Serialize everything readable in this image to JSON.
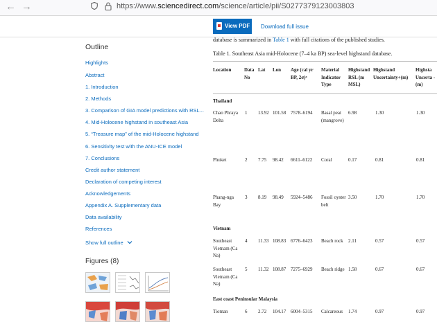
{
  "browser": {
    "url_prefix": "https://www.",
    "url_domain": "sciencedirect.com",
    "url_path": "/science/article/pii/S0277379123003803"
  },
  "toolbar": {
    "view_pdf": "View PDF",
    "download_issue": "Download full issue"
  },
  "outline": {
    "title": "Outline",
    "items": [
      "Highlights",
      "Abstract",
      "1. Introduction",
      "2. Methods",
      "3. Comparison of GIA model predictions with RSL...",
      "4. Mid-Holocene highstand in southeast Asia",
      "5. “Treasure map” of the mid-Holocene highstand",
      "6. Sensitivity test with the ANU-ICE model",
      "7. Conclusions",
      "Credit author statement",
      "Declaration of competing interest",
      "Acknowledgements",
      "Appendix A. Supplementary data",
      "Data availability",
      "References"
    ],
    "show_full": "Show full outline",
    "figures_title": "Figures (8)"
  },
  "article": {
    "lead_before": "database is summarized in ",
    "lead_link": "Table 1",
    "lead_after": " with full citations of the published studies.",
    "caption": "Table 1. Southeast Asia mid-Holocene (7–4 ka BP) sea-level highstand database.",
    "headers": {
      "location": "Location",
      "data_no": "Data No",
      "lat": "Lat",
      "lon": "Lon",
      "age": "Age (cal yr BP, 2σ)ᵃ",
      "material": "Material Indicator Type",
      "highstand_rsl": "Highstand RSL (m MSL)",
      "highstand_unc": "Highstand Uncertainty+(m)",
      "highstand_unc2": "Highsta Uncerta - (m)"
    },
    "regions": {
      "r1": "Thailand",
      "r2": "Vietnam",
      "r3": "East coast Peninsular Malaysia"
    },
    "rows": [
      {
        "location": "Chao Phraya Delta",
        "no": "1",
        "lat": "13.92",
        "lon": "101.58",
        "age": "7578–6194",
        "material": "Basal peat (mangrove)",
        "rsl": "6.98",
        "unc_plus": "1.30",
        "unc_minus": "1.30"
      },
      {
        "location": "Phuket",
        "no": "2",
        "lat": "7.75",
        "lon": "98.42",
        "age": "6611–6122",
        "material": "Coral",
        "rsl": "0.17",
        "unc_plus": "0.81",
        "unc_minus": "0.81"
      },
      {
        "location": "Phang-nga Bay",
        "no": "3",
        "lat": "8.19",
        "lon": "98.49",
        "age": "5924–5486",
        "material": "Fossil oyster belt",
        "rsl": "3.50",
        "unc_plus": "1.70",
        "unc_minus": "1.70"
      },
      {
        "location": "Southeast Vietnam (Ca Na)",
        "no": "4",
        "lat": "11.33",
        "lon": "108.83",
        "age": "6776–6423",
        "material": "Beach rock",
        "rsl": "2.11",
        "unc_plus": "0.57",
        "unc_minus": "0.57"
      },
      {
        "location": "Southeast Vietnam (Ca Na)",
        "no": "5",
        "lat": "11.32",
        "lon": "108.87",
        "age": "7275–6929",
        "material": "Beach ridge",
        "rsl": "1.58",
        "unc_plus": "0.67",
        "unc_minus": "0.67"
      },
      {
        "location": "Tioman",
        "no": "6",
        "lat": "2.72",
        "lon": "104.17",
        "age": "6004–5315",
        "material": "Calcareous",
        "rsl": "1.74",
        "unc_plus": "0.97",
        "unc_minus": "0.97"
      }
    ]
  }
}
